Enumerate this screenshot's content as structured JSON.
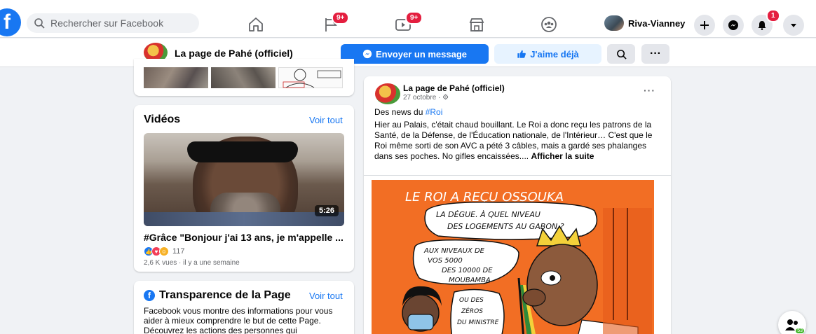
{
  "topbar": {
    "search_placeholder": "Rechercher sur Facebook",
    "badges": {
      "pages": "9+",
      "watch": "9+",
      "notifications": "1"
    },
    "user_name": "Riva-Vianney"
  },
  "page_header": {
    "page_name": "La page de Pahé (officiel)",
    "message_button": "Envoyer un message",
    "like_button": "J'aime déjà",
    "more_button": "···"
  },
  "videos": {
    "title": "Vidéos",
    "see_all": "Voir tout",
    "duration": "5:26",
    "video_title": "#Grâce \"Bonjour j'ai 13 ans, je m'appelle ...",
    "reaction_count": "117",
    "meta": "2,6 K vues · il y a une semaine"
  },
  "transparency": {
    "title": "Transparence de la Page",
    "see_all": "Voir tout",
    "text": "Facebook vous montre des informations pour vous aider à mieux comprendre le but de cette Page. Découvrez les actions des personnes qui"
  },
  "post": {
    "author": "La page de Pahé (officiel)",
    "date": "27 octobre · ",
    "more": "···",
    "tagline_prefix": "Des news du ",
    "tagline_tag": "#Roi",
    "body": "Hier au Palais, c'était chaud bouillant. Le Roi a donc reçu les patrons de la Santé, de la Défense,  de l'Éducation nationale, de l'Intérieur… C'est que le Roi même sorti de son AVC a pété 3 câbles, mais a gardé ses phalanges dans ses poches. No gifles encaissées.... ",
    "see_more": "Afficher la suite",
    "cartoon": {
      "caption": "LE ROI A REÇU OSSOUKA",
      "bubble1": "LA DÉGUE. À QUEL NIVEAU DES LOGEMENTS AU GABON ?",
      "bubble2": "AUX NIVEAUX DE VOS 5000 DES 10000 DE MOUBAMBA",
      "bubble3": "OU DES ZÉROS DU MINISTRE ..."
    }
  },
  "chat_fab": {
    "count": "53"
  },
  "colors": {
    "brand": "#1877f2",
    "badge": "#e41e3f",
    "cartoon_bg": "#f26e24"
  }
}
